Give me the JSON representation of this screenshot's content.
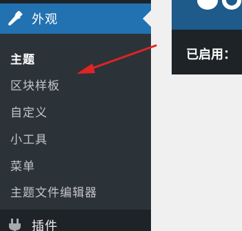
{
  "sidebar": {
    "active_menu": {
      "label": "外观",
      "icon": "paintbrush-icon"
    },
    "submenu": [
      {
        "label": "主题",
        "current": true
      },
      {
        "label": "区块样板",
        "current": false
      },
      {
        "label": "自定义",
        "current": false
      },
      {
        "label": "小工具",
        "current": false
      },
      {
        "label": "菜单",
        "current": false
      },
      {
        "label": "主题文件编辑器",
        "current": false
      }
    ],
    "next_menu": {
      "label": "插件",
      "icon": "plugin-icon"
    }
  },
  "content": {
    "active_theme_label": "已启用："
  },
  "colors": {
    "sidebar_bg": "#1d2327",
    "submenu_bg": "#2c3338",
    "active_menu_bg": "#2271b1",
    "annotation_arrow": "#e02424"
  }
}
